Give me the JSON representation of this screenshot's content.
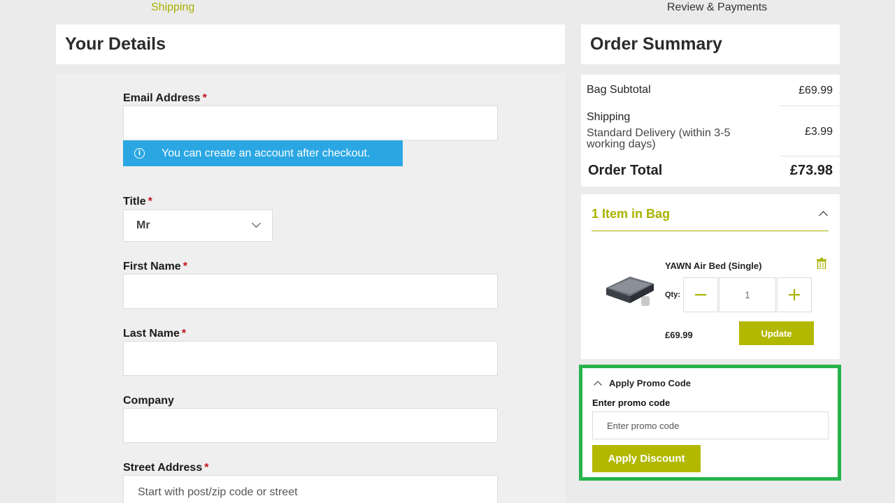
{
  "steps": {
    "shipping": "Shipping",
    "review": "Review & Payments"
  },
  "details": {
    "title": "Your Details",
    "email_label": "Email Address",
    "email_value": "",
    "info_message": "You can create an account after checkout.",
    "title_label": "Title",
    "title_value": "Mr",
    "first_name_label": "First Name",
    "last_name_label": "Last Name",
    "company_label": "Company",
    "street_label": "Street Address",
    "street_placeholder": "Start with post/zip code or street",
    "required_mark": "*"
  },
  "summary": {
    "title": "Order Summary",
    "subtotal_label": "Bag Subtotal",
    "subtotal_value": "£69.99",
    "shipping_label": "Shipping",
    "shipping_method": "Standard Delivery (within 3-5 working days)",
    "shipping_value": "£3.99",
    "total_label": "Order Total",
    "total_value": "£73.98"
  },
  "bag": {
    "title": "1 Item in Bag",
    "item": {
      "name": "YAWN Air Bed (Single)",
      "qty_label": "Qty:",
      "qty": "1",
      "price": "£69.99",
      "update_label": "Update",
      "minus_symbol": "−",
      "plus_symbol": "+"
    }
  },
  "promo": {
    "toggle_label": "Apply Promo Code",
    "field_label": "Enter promo code",
    "placeholder": "Enter promo code",
    "apply_label": "Apply Discount"
  },
  "colors": {
    "accent": "#b2b800",
    "info": "#2aa7e3",
    "highlight": "#27b34a"
  }
}
